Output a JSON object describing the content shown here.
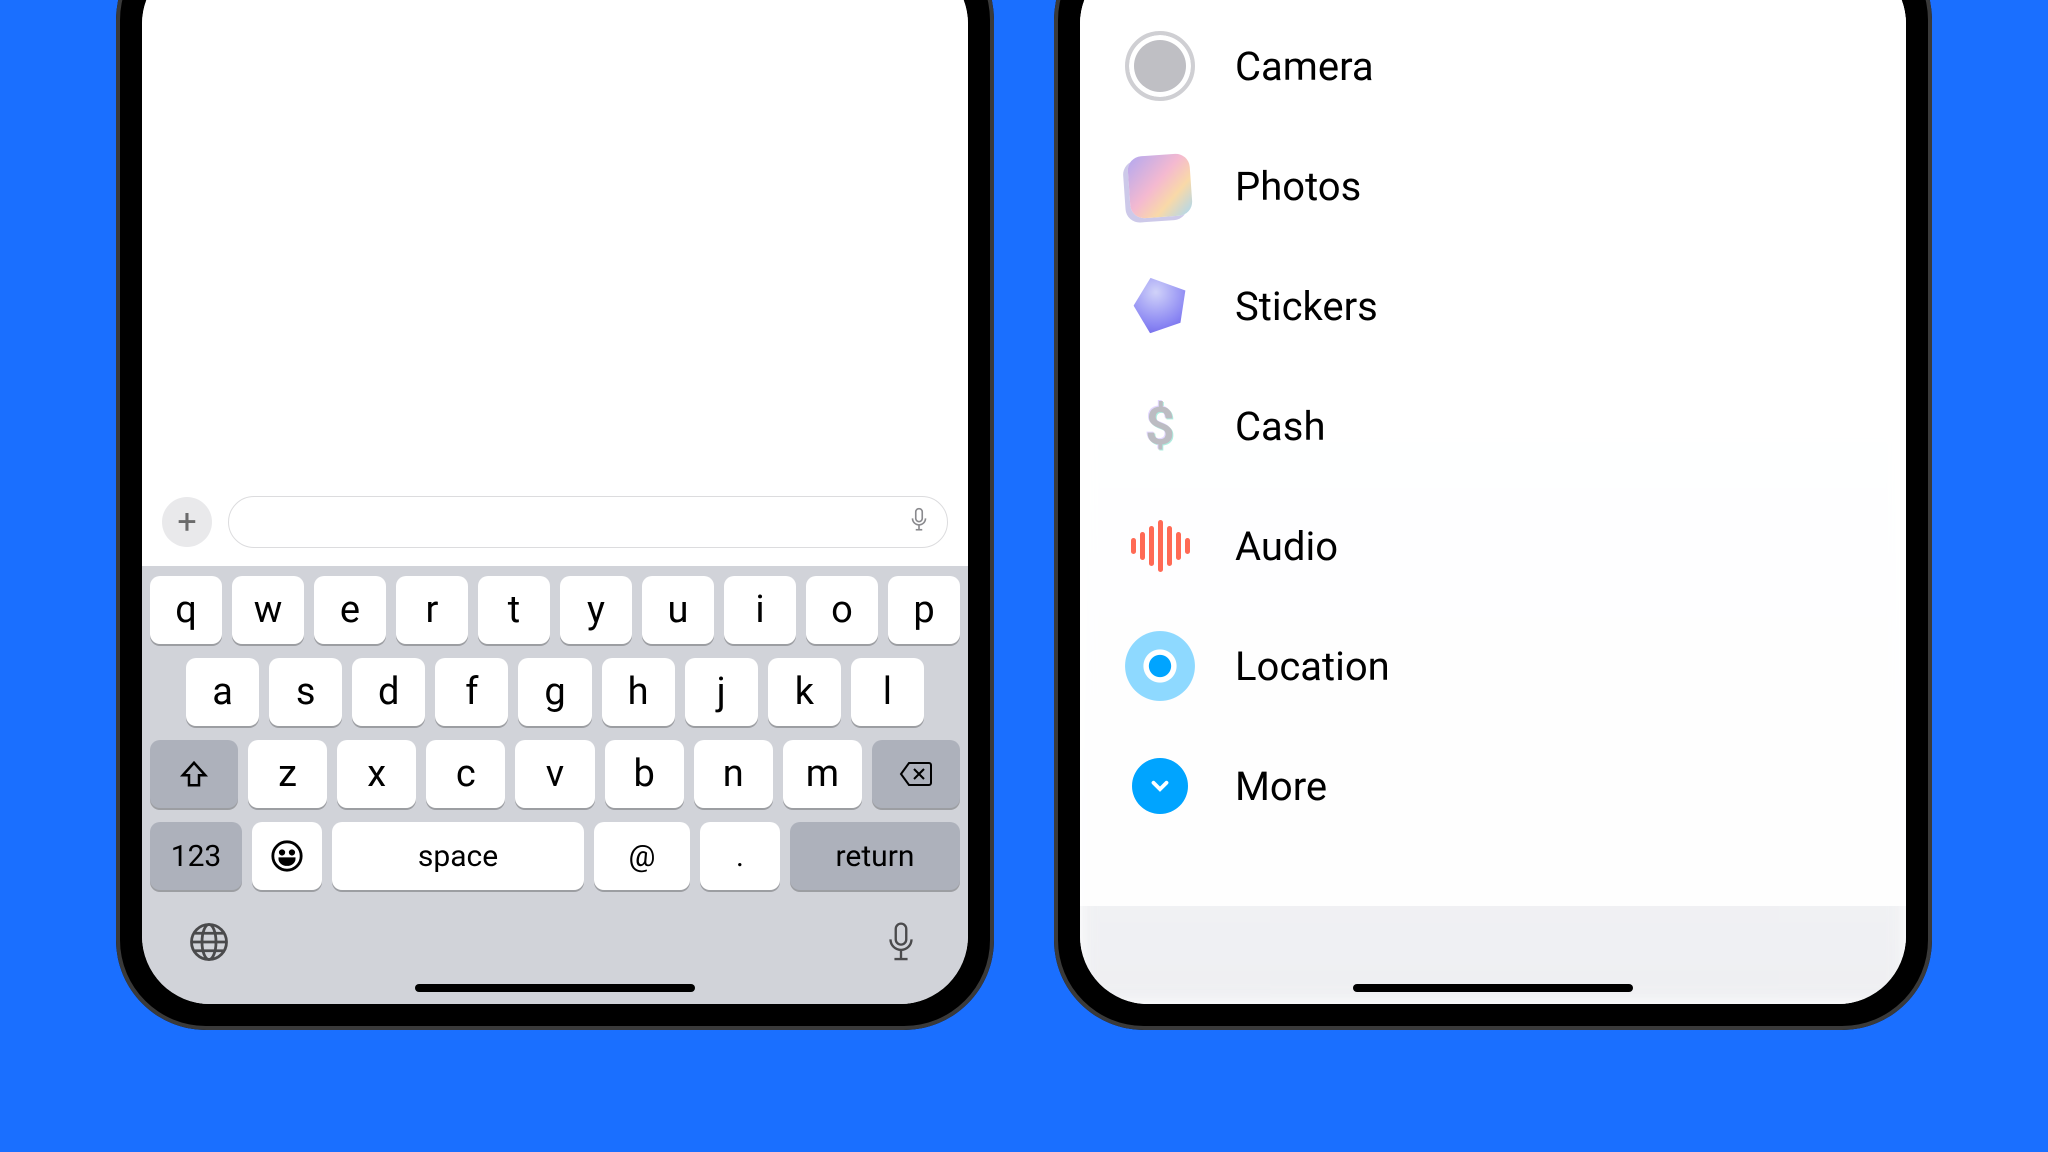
{
  "left": {
    "plus": "+",
    "keyboard": {
      "row1": [
        "q",
        "w",
        "e",
        "r",
        "t",
        "y",
        "u",
        "i",
        "o",
        "p"
      ],
      "row2": [
        "a",
        "s",
        "d",
        "f",
        "g",
        "h",
        "j",
        "k",
        "l"
      ],
      "row3": [
        "z",
        "x",
        "c",
        "v",
        "b",
        "n",
        "m"
      ],
      "key_123": "123",
      "key_space": "space",
      "key_at": "@",
      "key_dot": ".",
      "key_return": "return"
    }
  },
  "right": {
    "menu": {
      "camera": "Camera",
      "photos": "Photos",
      "stickers": "Stickers",
      "cash": "Cash",
      "audio": "Audio",
      "location": "Location",
      "more": "More"
    },
    "cash_symbol": "$"
  }
}
